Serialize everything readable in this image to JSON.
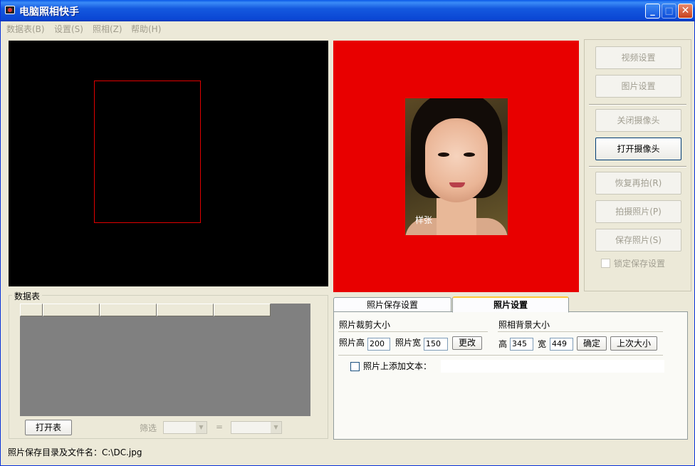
{
  "window": {
    "title": "电脑照相快手",
    "controls": {
      "minimize": "_",
      "maximize": "□",
      "close": "✕"
    }
  },
  "menu": [
    {
      "label": "数据表(B)"
    },
    {
      "label": "设置(S)"
    },
    {
      "label": "照相(Z)"
    },
    {
      "label": "帮助(H)"
    }
  ],
  "preview": {
    "sample_label": "样张"
  },
  "right_buttons": {
    "video_settings": "视频设置",
    "image_settings": "图片设置",
    "close_camera": "关闭摄像头",
    "open_camera": "打开摄像头",
    "retake": "恢复再拍(R)",
    "take_photo": "拍摄照片(P)",
    "save_photo": "保存照片(S)",
    "lock_save_settings": "锁定保存设置"
  },
  "datatable": {
    "group_title": "数据表",
    "open_button": "打开表",
    "filter_label": "筛选",
    "equals_label": "="
  },
  "tabs": [
    {
      "label": "照片保存设置",
      "active": false
    },
    {
      "label": "照片设置",
      "active": true
    }
  ],
  "photo_settings": {
    "crop_size_title": "照片裁剪大小",
    "photo_height_label": "照片高",
    "photo_height_value": "200",
    "photo_width_label": "照片宽",
    "photo_width_value": "150",
    "change_button": "更改",
    "bg_size_title": "照相背景大小",
    "bg_height_label": "高",
    "bg_height_value": "345",
    "bg_width_label": "宽",
    "bg_width_value": "449",
    "ok_button": "确定",
    "last_size_button": "上次大小",
    "add_text_label": "照片上添加文本：",
    "add_text_value": ""
  },
  "status": {
    "text": "照片保存目录及文件名：C:\\DC.jpg"
  },
  "colors": {
    "titlebar": "#0a46d4",
    "preview_bg": "#e80000",
    "camera_bg": "#000000",
    "crop_rect": "#e00000"
  }
}
